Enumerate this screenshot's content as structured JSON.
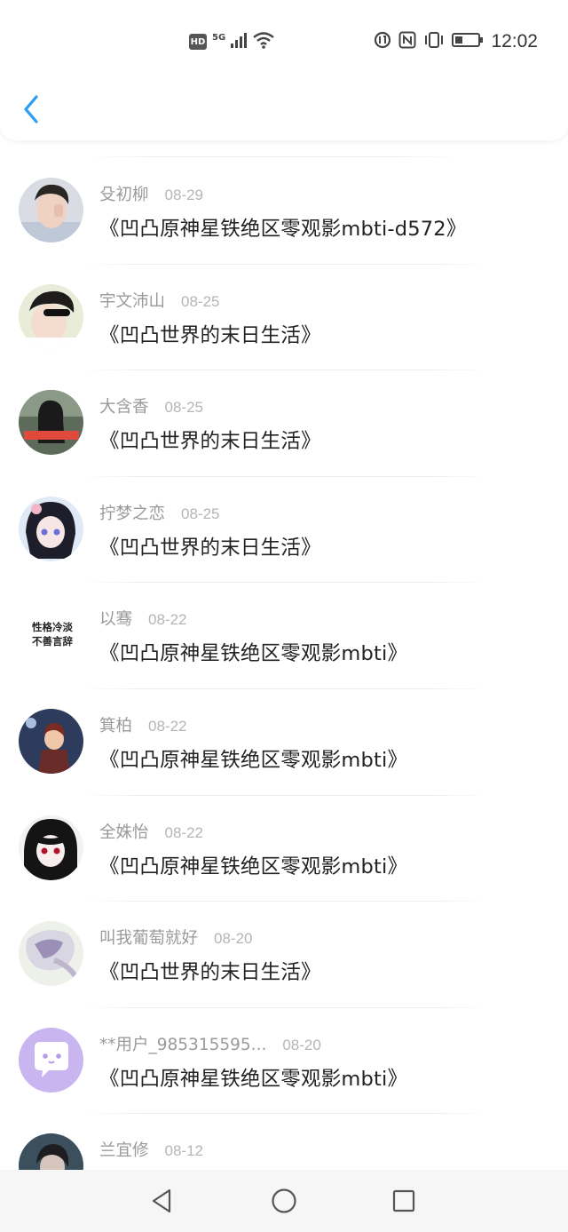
{
  "status_bar": {
    "time": "12:02",
    "hd": "HD",
    "network": "5G"
  },
  "header": {
    "back_icon": "chevron-left-icon",
    "accent": "#2a9df4"
  },
  "list": {
    "items": [
      {
        "user": "殳初柳",
        "date": "08-29",
        "title": "《凹凸原神星铁绝区零观影mbti-d572》"
      },
      {
        "user": "宇文沛山",
        "date": "08-25",
        "title": "《凹凸世界的末日生活》"
      },
      {
        "user": "大含香",
        "date": "08-25",
        "title": "《凹凸世界的末日生活》"
      },
      {
        "user": "拧梦之恋",
        "date": "08-25",
        "title": "《凹凸世界的末日生活》"
      },
      {
        "user": "以骞",
        "date": "08-22",
        "title": "《凹凸原神星铁绝区零观影mbti》"
      },
      {
        "user": "箕柏",
        "date": "08-22",
        "title": "《凹凸原神星铁绝区零观影mbti》"
      },
      {
        "user": "全姝怡",
        "date": "08-22",
        "title": "《凹凸原神星铁绝区零观影mbti》"
      },
      {
        "user": "叫我葡萄就好",
        "date": "08-20",
        "title": "《凹凸世界的末日生活》"
      },
      {
        "user": "**用户_985315595...",
        "date": "08-20",
        "title": "《凹凸原神星铁绝区零观影mbti》"
      },
      {
        "user": "兰宜修",
        "date": "08-12",
        "title": ""
      }
    ]
  },
  "avatar_text": {
    "a5_line1": "性格冷淡",
    "a5_line2": "不善言辞"
  },
  "navbar": {
    "back": "triangle-back-icon",
    "home": "circle-home-icon",
    "recents": "square-recents-icon"
  }
}
